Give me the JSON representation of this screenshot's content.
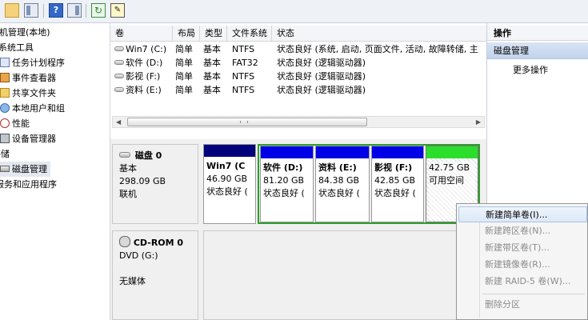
{
  "tree": {
    "root": "机管理(本地)",
    "system_tools": "系统工具",
    "items": [
      "任务计划程序",
      "事件查看器",
      "共享文件夹",
      "本地用户和组",
      "性能",
      "设备管理器"
    ],
    "storage": "存储",
    "disk_management": "磁盘管理",
    "services": "服务和应用程序"
  },
  "volumes": {
    "headers": [
      "卷",
      "布局",
      "类型",
      "文件系统",
      "状态"
    ],
    "rows": [
      {
        "name": "Win7 (C:)",
        "layout": "简单",
        "type": "基本",
        "fs": "NTFS",
        "status": "状态良好 (系统, 启动, 页面文件, 活动, 故障转储, 主"
      },
      {
        "name": "软件 (D:)",
        "layout": "简单",
        "type": "基本",
        "fs": "FAT32",
        "status": "状态良好 (逻辑驱动器)"
      },
      {
        "name": "影视 (F:)",
        "layout": "简单",
        "type": "基本",
        "fs": "NTFS",
        "status": "状态良好 (逻辑驱动器)"
      },
      {
        "name": "资料 (E:)",
        "layout": "简单",
        "type": "基本",
        "fs": "NTFS",
        "status": "状态良好 (逻辑驱动器)"
      }
    ]
  },
  "disk0": {
    "title": "磁盘 0",
    "type": "基本",
    "size": "298.09 GB",
    "state": "联机",
    "partitions": [
      {
        "name": "Win7  (C",
        "size": "46.90 GB",
        "status": "状态良好 (",
        "bar": "#00007b"
      },
      {
        "name": "软件  (D:)",
        "size": "81.20 GB",
        "status": "状态良好 (",
        "bar": "#0000e6"
      },
      {
        "name": "资料   (E:)",
        "size": "84.38 GB",
        "status": "状态良好 (",
        "bar": "#0000e6"
      },
      {
        "name": "影视   (F:)",
        "size": "42.85 GB",
        "status": "状态良好 (",
        "bar": "#0000e6"
      },
      {
        "name": "",
        "size": "42.75 GB",
        "status": "可用空间",
        "bar": "#2cde2c"
      }
    ]
  },
  "cdrom": {
    "title": "CD-ROM 0",
    "drive": "DVD (G:)",
    "media": "无媒体"
  },
  "actions": {
    "header": "操作",
    "selected": "磁盘管理",
    "more": "更多操作"
  },
  "context_menu": {
    "items": [
      "新建简单卷(I)...",
      "新建跨区卷(N)...",
      "新建带区卷(T)...",
      "新建镜像卷(R)...",
      "新建 RAID-5 卷(W)..."
    ],
    "last_partial": "删除分区"
  },
  "colors": {
    "primary_bar": "#00007b",
    "logical_bar": "#0000e6",
    "free_bar": "#2cde2c",
    "extended_border": "#2e9e2e"
  }
}
